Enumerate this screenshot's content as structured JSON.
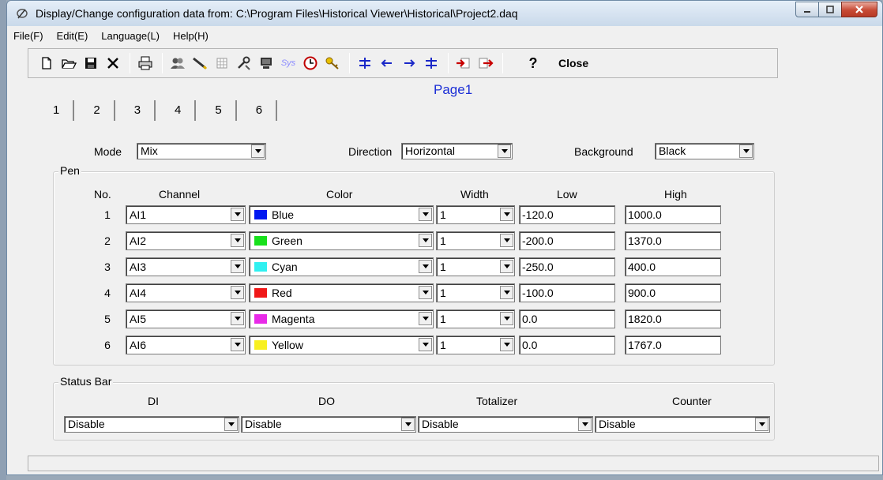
{
  "window": {
    "title": "Display/Change configuration data from: C:\\Program Files\\Historical Viewer\\Historical\\Project2.daq"
  },
  "menu": [
    "File(F)",
    "Edit(E)",
    "Language(L)",
    "Help(H)"
  ],
  "toolbar": {
    "sys_label": "Sys",
    "help_label": "?",
    "close_label": "Close"
  },
  "page_title": "Page1",
  "tabs": [
    "1",
    "2",
    "3",
    "4",
    "5",
    "6"
  ],
  "settings": {
    "mode_label": "Mode",
    "mode_value": "Mix",
    "direction_label": "Direction",
    "direction_value": "Horizontal",
    "background_label": "Background",
    "background_value": "Black"
  },
  "pen": {
    "group_title": "Pen",
    "headers": {
      "no": "No.",
      "channel": "Channel",
      "color": "Color",
      "width": "Width",
      "low": "Low",
      "high": "High"
    },
    "rows": [
      {
        "no": "1",
        "channel": "AI1",
        "color": "Blue",
        "swatch": "#0018f0",
        "width": "1",
        "low": "-120.0",
        "high": "1000.0"
      },
      {
        "no": "2",
        "channel": "AI2",
        "color": "Green",
        "swatch": "#18e01c",
        "width": "1",
        "low": "-200.0",
        "high": "1370.0"
      },
      {
        "no": "3",
        "channel": "AI3",
        "color": "Cyan",
        "swatch": "#30f0f0",
        "width": "1",
        "low": "-250.0",
        "high": "400.0"
      },
      {
        "no": "4",
        "channel": "AI4",
        "color": "Red",
        "swatch": "#f01818",
        "width": "1",
        "low": "-100.0",
        "high": "900.0"
      },
      {
        "no": "5",
        "channel": "AI5",
        "color": "Magenta",
        "swatch": "#e82ae8",
        "width": "1",
        "low": "0.0",
        "high": "1820.0"
      },
      {
        "no": "6",
        "channel": "AI6",
        "color": "Yellow",
        "swatch": "#f8f020",
        "width": "1",
        "low": "0.0",
        "high": "1767.0"
      }
    ]
  },
  "status_bar": {
    "group_title": "Status Bar",
    "di_label": "DI",
    "di_value": "Disable",
    "do_label": "DO",
    "do_value": "Disable",
    "totalizer_label": "Totalizer",
    "totalizer_value": "Disable",
    "counter_label": "Counter",
    "counter_value": "Disable"
  }
}
